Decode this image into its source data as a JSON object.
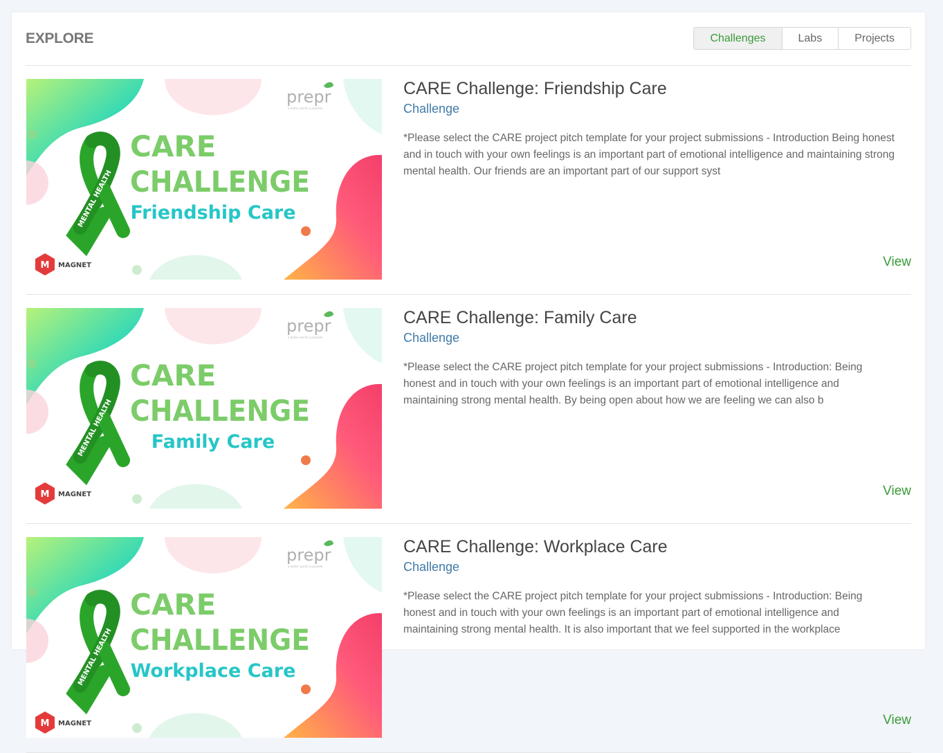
{
  "header": {
    "title": "EXPLORE",
    "tabs": [
      {
        "label": "Challenges",
        "active": true
      },
      {
        "label": "Labs",
        "active": false
      },
      {
        "label": "Projects",
        "active": false
      }
    ]
  },
  "colors": {
    "accent_green": "#3a9a3a",
    "type_blue": "#3f7aa8",
    "ribbon_green": "#2aa52a",
    "banner_text_green": "#7ccc6a",
    "banner_subtitle_cyan": "#27c6c7",
    "magnet_red": "#e33b3b"
  },
  "cards": [
    {
      "title": "CARE Challenge: Friendship Care",
      "type": "Challenge",
      "description": "*Please select the CARE project pitch template for your project submissions -    Introduction Being honest and in touch with your own feelings is an important part of emotional intelligence and maintaining strong mental health. Our friends are an important part of our support syst",
      "view_label": "View",
      "banner": {
        "line1": "CARE",
        "line2": "CHALLENGE",
        "subtitle": "Friendship Care",
        "ribbon_text": "MENTAL HEALTH",
        "brand": "prepr",
        "brand_tagline": "a better world is possible",
        "partner": "MAGNET"
      }
    },
    {
      "title": "CARE Challenge: Family Care",
      "type": "Challenge",
      "description": "*Please select the CARE project pitch template for your project submissions -    Introduction: Being honest and in touch with your own feelings is an important part of emotional intelligence and maintaining strong mental health. By being open about how we are feeling we can also b",
      "view_label": "View",
      "banner": {
        "line1": "CARE",
        "line2": "CHALLENGE",
        "subtitle": "Family Care",
        "ribbon_text": "MENTAL HEALTH",
        "brand": "prepr",
        "brand_tagline": "a better world is possible",
        "partner": "MAGNET"
      }
    },
    {
      "title": "CARE Challenge: Workplace Care",
      "type": "Challenge",
      "description": "*Please select the CARE project pitch template for your project submissions -  Introduction: Being honest and in touch with your own feelings is an important part of emotional intelligence and maintaining strong mental health. It is also important that we feel supported in the workplace",
      "view_label": "View",
      "banner": {
        "line1": "CARE",
        "line2": "CHALLENGE",
        "subtitle": "Workplace Care",
        "ribbon_text": "MENTAL HEALTH",
        "brand": "prepr",
        "brand_tagline": "a better world is possible",
        "partner": "MAGNET"
      }
    }
  ]
}
